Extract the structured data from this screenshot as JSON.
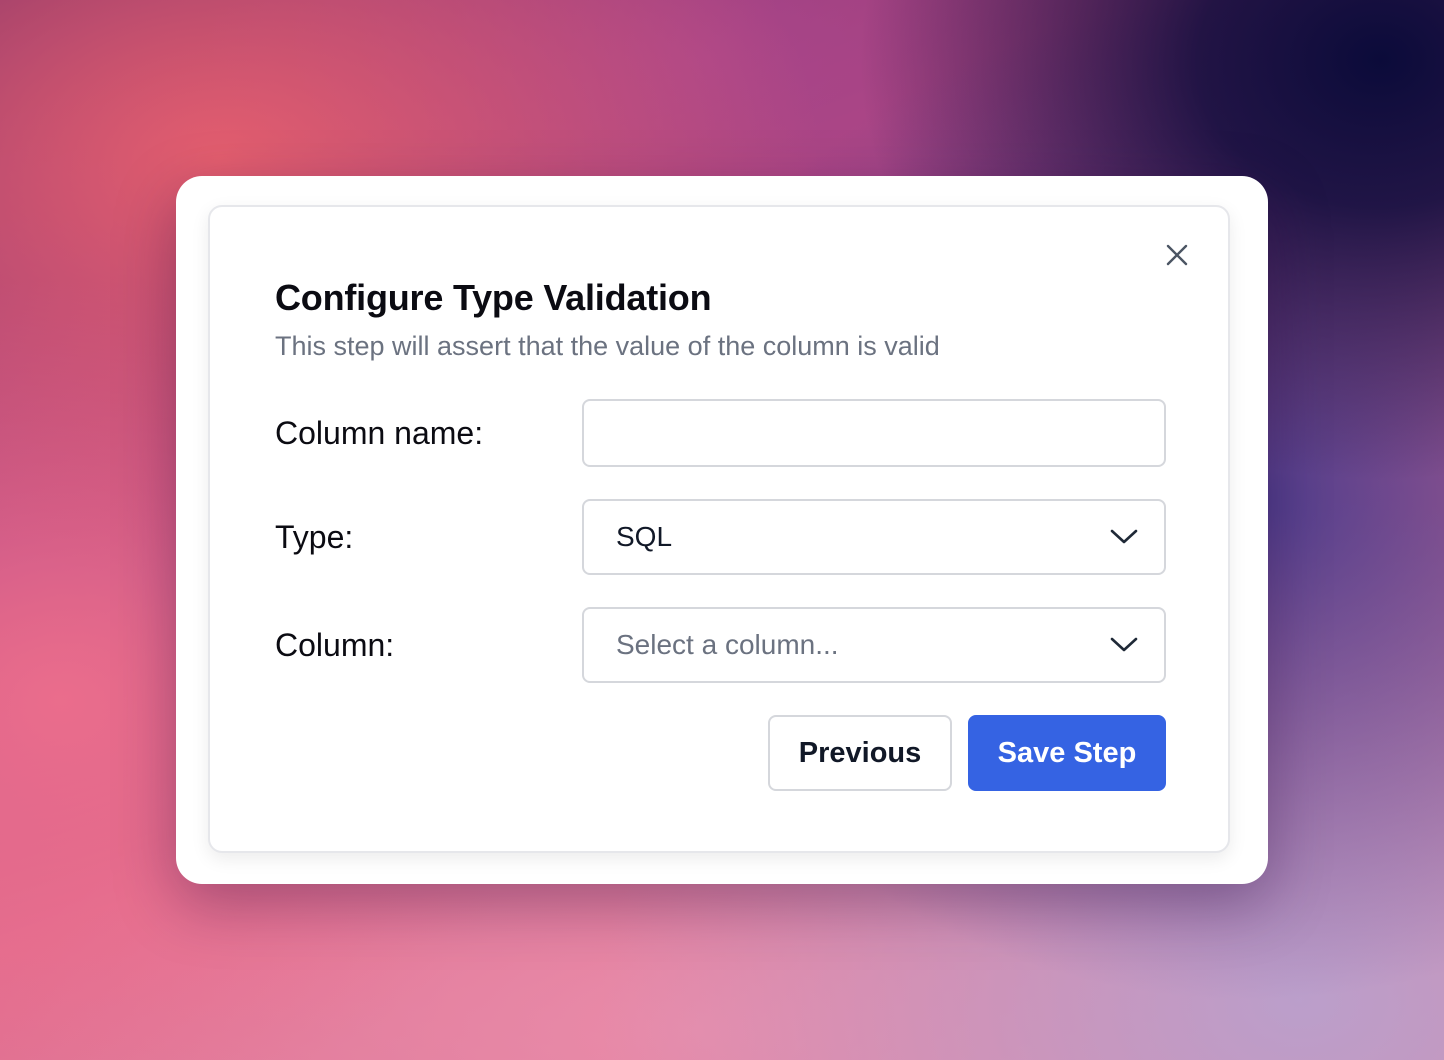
{
  "dialog": {
    "title": "Configure Type Validation",
    "subtitle": "This step will assert that the value of the column is valid",
    "close_icon": "close-icon"
  },
  "form": {
    "column_name": {
      "label": "Column name:",
      "value": "",
      "placeholder": ""
    },
    "type": {
      "label": "Type:",
      "selected": "SQL",
      "icon": "chevron-down-icon"
    },
    "column": {
      "label": "Column:",
      "placeholder": "Select a column...",
      "icon": "chevron-down-icon"
    }
  },
  "actions": {
    "previous_label": "Previous",
    "save_label": "Save Step"
  },
  "colors": {
    "primary": "#3563e3",
    "text": "#111827",
    "muted": "#6b7280",
    "border": "#d5d7dc"
  }
}
